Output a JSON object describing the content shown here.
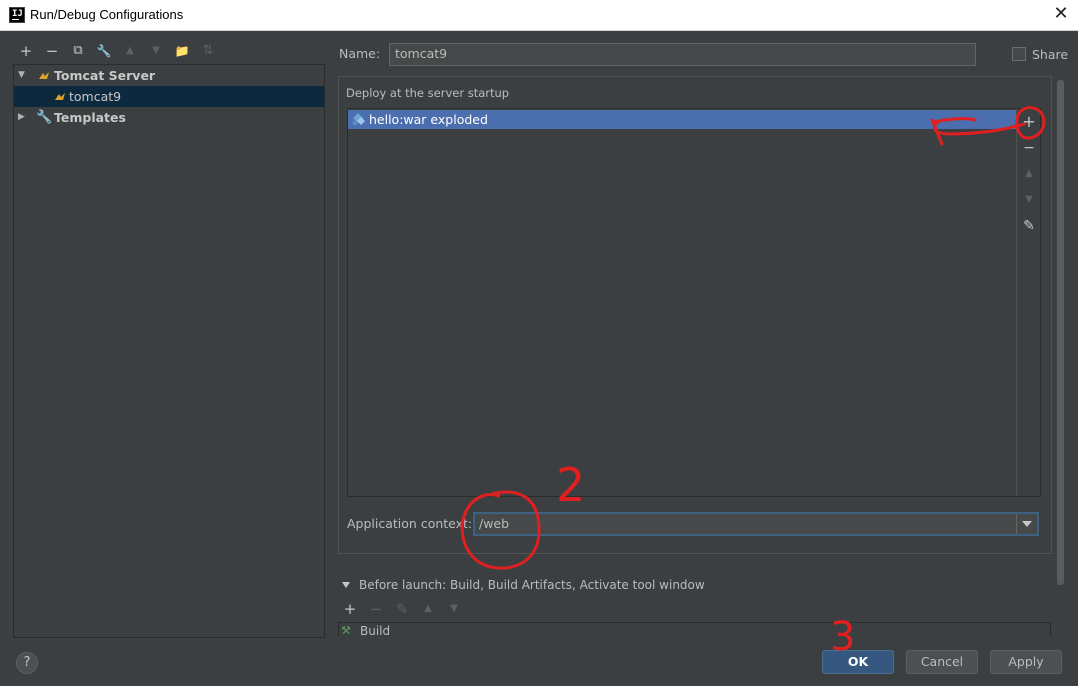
{
  "window": {
    "title": "Run/Debug Configurations",
    "close_glyph": "✕",
    "logo_text": "IJ"
  },
  "toolbar": {
    "add": "+",
    "remove": "−",
    "copy": "⧉",
    "edit": "🔧",
    "up": "▲",
    "down": "▼",
    "folder": "📁",
    "sort": "⇅"
  },
  "tree": {
    "items": [
      {
        "label": "Tomcat Server",
        "expanded": true
      },
      {
        "label": "tomcat9",
        "selected": true
      },
      {
        "label": "Templates",
        "expanded": false
      }
    ]
  },
  "config": {
    "name_label": "Name:",
    "name_value": "tomcat9",
    "share_label": "Share",
    "deploy_label": "Deploy at the server startup",
    "artifacts": [
      {
        "label": "hello:war exploded"
      }
    ],
    "side_tools": {
      "add": "+",
      "remove": "−",
      "up": "▲",
      "down": "▼",
      "edit": "✎"
    },
    "app_context_label": "Application context:",
    "app_context_value": "/web",
    "before_launch_label": "Before launch: Build, Build Artifacts, Activate tool window",
    "before_launch_tools": {
      "add": "+",
      "remove": "−",
      "edit": "✎",
      "up": "▲",
      "down": "▼"
    },
    "before_launch_items": [
      "Build"
    ]
  },
  "footer": {
    "help": "?",
    "ok": "OK",
    "cancel": "Cancel",
    "apply": "Apply"
  },
  "annotations": {
    "num_2": "2",
    "num_3": "3",
    "color": "#e02020"
  }
}
